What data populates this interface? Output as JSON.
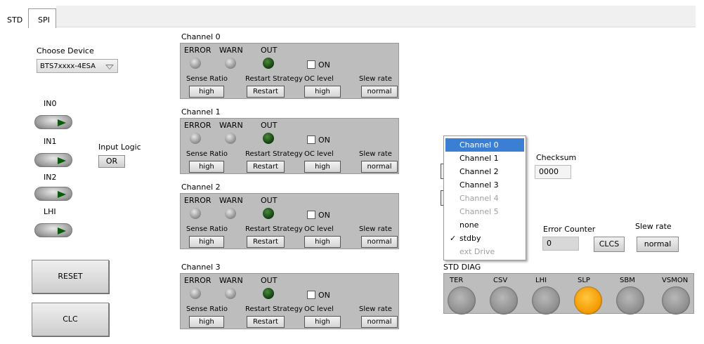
{
  "tabs": [
    {
      "label": "STD",
      "active": true
    },
    {
      "label": "SPI",
      "active": false
    }
  ],
  "device": {
    "label": "Choose Device",
    "value": "BTS7xxxx-4ESA"
  },
  "inputs": [
    {
      "label": "IN0"
    },
    {
      "label": "IN1"
    },
    {
      "label": "IN2"
    },
    {
      "label": "LHI"
    }
  ],
  "input_logic": {
    "label": "Input Logic",
    "value": "OR"
  },
  "buttons": {
    "reset": "RESET",
    "clc": "CLC",
    "clcs": "CLCS"
  },
  "channels": [
    {
      "title": "Channel 0",
      "error": "ERROR",
      "warn": "WARN",
      "out": "OUT",
      "oc_on": "ON",
      "sense_ratio_label": "Sense Ratio",
      "restart_strategy_label": "Restart Strategy",
      "oc_level_label": "OC level",
      "slew_rate_label": "Slew rate",
      "sense_ratio": "high",
      "restart": "Restart",
      "oc_level": "high",
      "slew_rate": "normal"
    },
    {
      "title": "Channel 1",
      "error": "ERROR",
      "warn": "WARN",
      "out": "OUT",
      "oc_on": "ON",
      "sense_ratio_label": "Sense Ratio",
      "restart_strategy_label": "Restart Strategy",
      "oc_level_label": "OC level",
      "slew_rate_label": "Slew rate",
      "sense_ratio": "high",
      "restart": "Restart",
      "oc_level": "high",
      "slew_rate": "normal"
    },
    {
      "title": "Channel 2",
      "error": "ERROR",
      "warn": "WARN",
      "out": "OUT",
      "oc_on": "ON",
      "sense_ratio_label": "Sense Ratio",
      "restart_strategy_label": "Restart Strategy",
      "oc_level_label": "OC level",
      "slew_rate_label": "Slew rate",
      "sense_ratio": "high",
      "restart": "Restart",
      "oc_level": "high",
      "slew_rate": "normal"
    },
    {
      "title": "Channel 3",
      "error": "ERROR",
      "warn": "WARN",
      "out": "OUT",
      "oc_on": "ON",
      "sense_ratio_label": "Sense Ratio",
      "restart_strategy_label": "Restart Strategy",
      "oc_level_label": "OC level",
      "slew_rate_label": "Slew rate",
      "sense_ratio": "high",
      "restart": "Restart",
      "oc_level": "high",
      "slew_rate": "normal"
    }
  ],
  "menu": {
    "items": [
      {
        "label": "Channel 0",
        "state": "highlighted"
      },
      {
        "label": "Channel 1",
        "state": "enabled"
      },
      {
        "label": "Channel 2",
        "state": "enabled"
      },
      {
        "label": "Channel 3",
        "state": "enabled"
      },
      {
        "label": "Channel 4",
        "state": "disabled"
      },
      {
        "label": "Channel 5",
        "state": "disabled"
      },
      {
        "label": "none",
        "state": "enabled"
      },
      {
        "label": "stdby",
        "state": "checked"
      },
      {
        "label": "ext Drive",
        "state": "disabled"
      }
    ],
    "check_glyph": "✓"
  },
  "checksum": {
    "label": "Checksum",
    "value": "0000"
  },
  "error_counter": {
    "label": "Error Counter",
    "value": "0"
  },
  "slew_rate_global": {
    "label": "Slew rate",
    "value": "normal"
  },
  "std_diag": {
    "title": "STD DIAG",
    "leds": [
      {
        "label": "TER",
        "on": false
      },
      {
        "label": "CSV",
        "on": false
      },
      {
        "label": "LHI",
        "on": false
      },
      {
        "label": "SLP",
        "on": true
      },
      {
        "label": "SBM",
        "on": false
      },
      {
        "label": "VSMON",
        "on": false
      }
    ],
    "on_color": "#f59a00"
  }
}
